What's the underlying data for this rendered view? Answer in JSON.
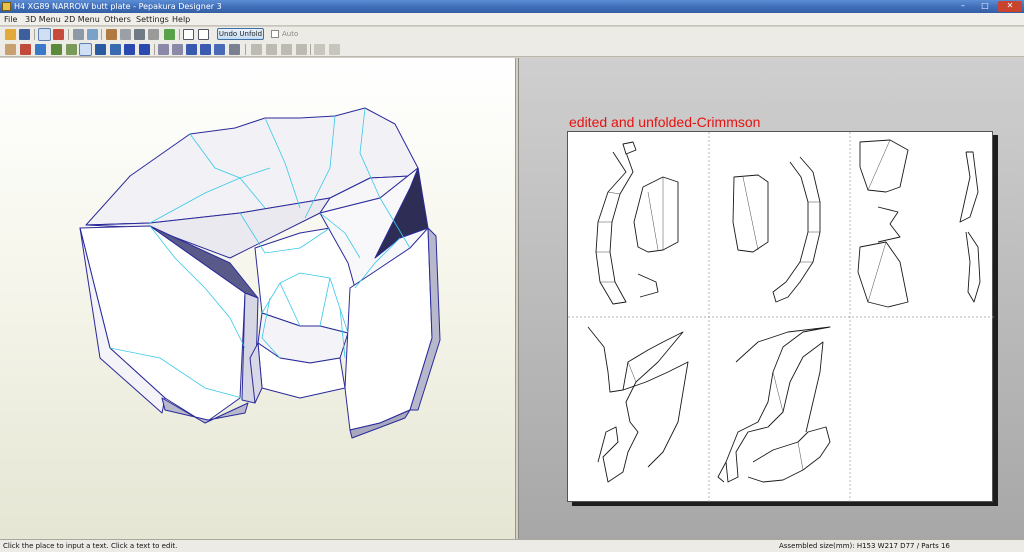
{
  "window": {
    "title": "H4 XG89 NARROW butt plate - Pepakura Designer 3",
    "minimize_glyph": "–",
    "maximize_glyph": "□",
    "close_glyph": "✕"
  },
  "menu": [
    "File",
    "3D Menu",
    "2D Menu",
    "Others",
    "Settings",
    "Help"
  ],
  "toolbar": {
    "undo_unfold_label": "Undo Unfold",
    "auto_label": "Auto",
    "auto_checked": false
  },
  "sheet": {
    "annotation": "edited and unfolded-Crimmson"
  },
  "status": {
    "hint": "Click the place to input a text. Click a text to edit.",
    "assembled_size": "Assembled size(mm): H153 W217 D77 / Parts 16"
  },
  "colors": {
    "titlebar": "#3f6db8",
    "annotation": "#e8120f",
    "model_edge": "#2a2a9a",
    "fold_line": "#38c8e8"
  },
  "icons": {
    "toolbar1": [
      "open-folder-icon",
      "save-icon",
      "lightbulb-icon",
      "color-cube-icon",
      "rotate-icon",
      "mirror-icon",
      "pencil-icon",
      "box-icon",
      "anchor-icon",
      "edge-icon",
      "flag-icon",
      "single-page-icon",
      "double-page-icon"
    ],
    "toolbar2": [
      "select-icon",
      "node-icon",
      "texture-icon",
      "split-icon",
      "join-icon",
      "rect-icon",
      "tab-icon",
      "rotate-part-icon",
      "undo-arrow-icon",
      "redo-arrow-icon",
      "grid-icon",
      "grid2-icon",
      "flap-icon",
      "flap2-icon",
      "align-left-icon",
      "align-center-icon",
      "align-right-icon",
      "distribute-icon",
      "zoom-in-icon",
      "zoom-out-icon"
    ]
  }
}
